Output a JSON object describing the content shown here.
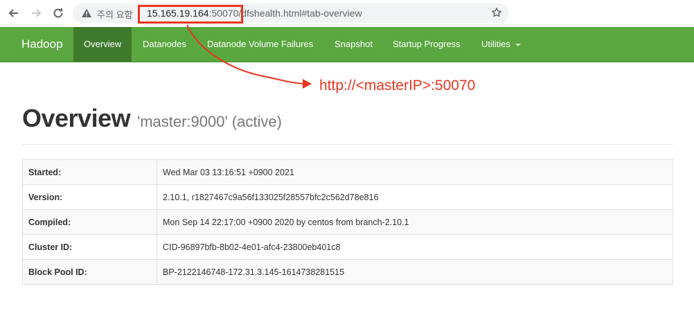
{
  "browser": {
    "security_warning": "주의 요함",
    "url_host": "15.165.19.164",
    "url_rest": ":50070/dfshealth.html#tab-overview"
  },
  "navbar": {
    "brand": "Hadoop",
    "items": [
      {
        "label": "Overview",
        "active": true
      },
      {
        "label": "Datanodes"
      },
      {
        "label": "Datanode Volume Failures"
      },
      {
        "label": "Snapshot"
      },
      {
        "label": "Startup Progress"
      },
      {
        "label": "Utilities"
      }
    ]
  },
  "annotation": {
    "text": "http://<masterIP>:50070",
    "color": "#e8361f"
  },
  "overview": {
    "title": "Overview",
    "subtitle": "'master:9000' (active)",
    "rows": [
      {
        "label": "Started:",
        "value": "Wed Mar 03 13:16:51 +0900 2021"
      },
      {
        "label": "Version:",
        "value": "2.10.1, r1827467c9a56f133025f28557bfc2c562d78e816"
      },
      {
        "label": "Compiled:",
        "value": "Mon Sep 14 22:17:00 +0900 2020 by centos from branch-2.10.1"
      },
      {
        "label": "Cluster ID:",
        "value": "CID-96897bfb-8b02-4e01-afc4-23800eb401c8"
      },
      {
        "label": "Block Pool ID:",
        "value": "BP-2122146748-172.31.3.145-1614738281515"
      }
    ]
  },
  "colors": {
    "navbar": "#5aa63f",
    "navbar_active": "#3e7a2c",
    "annotation": "#e8361f"
  }
}
